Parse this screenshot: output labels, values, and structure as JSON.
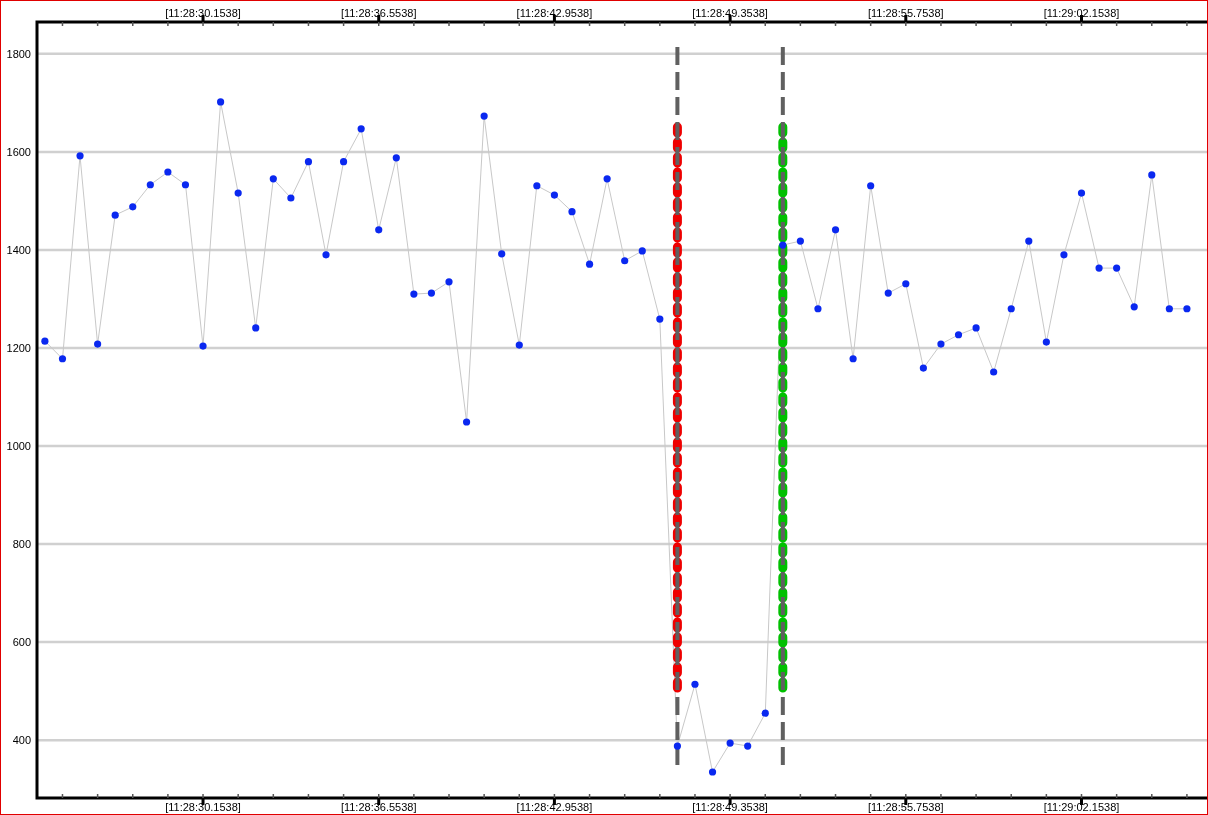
{
  "chart": {
    "chart_data": {
      "type": "line",
      "ylim": [
        282,
        1865
      ],
      "grid": true,
      "categories": [
        null,
        null,
        null,
        null,
        null,
        null,
        null,
        null,
        null,
        "[11:28:30.1538]",
        null,
        null,
        null,
        null,
        null,
        null,
        null,
        null,
        null,
        "[11:28:36.5538]",
        null,
        null,
        null,
        null,
        null,
        null,
        null,
        null,
        null,
        "[11:28:42.9538]",
        null,
        null,
        null,
        null,
        null,
        null,
        null,
        null,
        null,
        "[11:28:49.3538]",
        null,
        null,
        null,
        null,
        null,
        null,
        null,
        null,
        null,
        "[11:28:55.7538]",
        null,
        null,
        null,
        null,
        null,
        null,
        null,
        null,
        null,
        "[11:29:02.1538]",
        null,
        null,
        null,
        null,
        null,
        null
      ],
      "yticks": [
        400,
        600,
        800,
        1000,
        1200,
        1400,
        1600,
        1800
      ],
      "series": [
        {
          "color": "#0a28f0",
          "marker": "circle",
          "values": [
            1214,
            1178,
            1592,
            1208,
            1471,
            1488,
            1533,
            1559,
            1533,
            1204,
            1702,
            1516,
            1241,
            1545,
            1506,
            1580,
            1390,
            1580,
            1647,
            1441,
            1588,
            1310,
            1312,
            1335,
            1049,
            1673,
            1392,
            1206,
            1531,
            1512,
            1478,
            1371,
            1545,
            1378,
            1398,
            1259,
            388,
            514,
            335,
            394,
            388,
            455,
            1410,
            1418,
            1280,
            1441,
            1178,
            1531,
            1312,
            1331,
            1159,
            1208,
            1227,
            1241,
            1151,
            1280,
            1418,
            1212,
            1390,
            1516,
            1363,
            1363,
            1284,
            1553,
            1280,
            1280
          ]
        }
      ]
    }
  }
}
